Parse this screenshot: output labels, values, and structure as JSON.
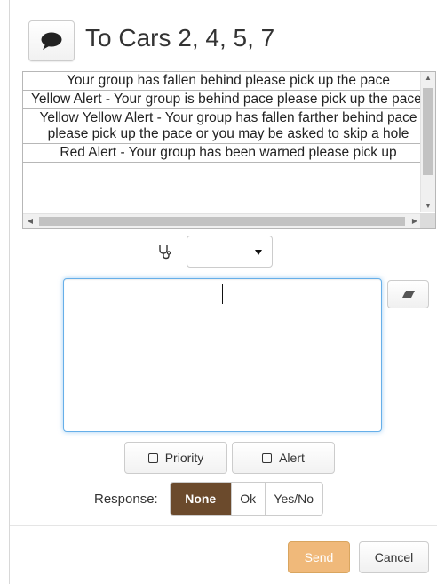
{
  "header": {
    "title": "To Cars 2, 4, 5, 7",
    "chat_icon": "speech-bubble-icon"
  },
  "messages": {
    "items": [
      "Your group has fallen behind please pick up the pace",
      "Yellow Alert - Your group is behind pace please pick up the pace.",
      "Yellow Yellow Alert - Your group has fallen farther behind pace please pick up the pace or you may be asked to skip a hole",
      "Red Alert - Your group has been warned please pick up"
    ],
    "scroll_icons": {
      "up": "▲",
      "down": "▼",
      "left": "◀",
      "right": "▶"
    }
  },
  "selector": {
    "icon": "stethoscope-icon",
    "value": ""
  },
  "compose": {
    "value": "",
    "placeholder": "",
    "clear_icon": "eraser-icon"
  },
  "toggles": {
    "priority_label": "Priority",
    "alert_label": "Alert"
  },
  "response": {
    "label": "Response:",
    "options": [
      "None",
      "Ok",
      "Yes/No"
    ],
    "selected": "None"
  },
  "footer": {
    "send_label": "Send",
    "cancel_label": "Cancel"
  },
  "colors": {
    "accent_selected": "#6b4a2c",
    "send_button": "#f0b97a",
    "focus_border": "#66afe9"
  }
}
